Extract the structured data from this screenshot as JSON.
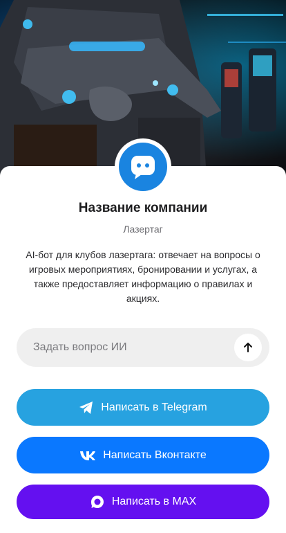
{
  "hero": {
    "image": "laser-tag-player-with-blaster"
  },
  "company": {
    "avatar_icon": "chat-bot-icon",
    "name": "Название компании",
    "category": "Лазертаг",
    "description": "AI-бот для клубов лазертага: отвечает на вопросы о игровых мероприятиях, бронировании и услугах, а также предоставляет информацию о правилах и акциях."
  },
  "ask": {
    "value": "",
    "placeholder": "Задать вопрос ИИ",
    "send_icon": "arrow-up-icon"
  },
  "buttons": {
    "telegram": {
      "label": "Написать в Telegram",
      "icon": "telegram-icon",
      "color": "#27a2e0"
    },
    "vk": {
      "label": "Написать Вконтакте",
      "icon": "vk-icon",
      "color": "#0a78ff"
    },
    "max": {
      "label": "Написать в MAX",
      "icon": "max-icon",
      "color": "#6410f0"
    }
  },
  "colors": {
    "brand": "#1a84e0",
    "card_bg": "#ffffff",
    "input_bg": "#efefef"
  }
}
